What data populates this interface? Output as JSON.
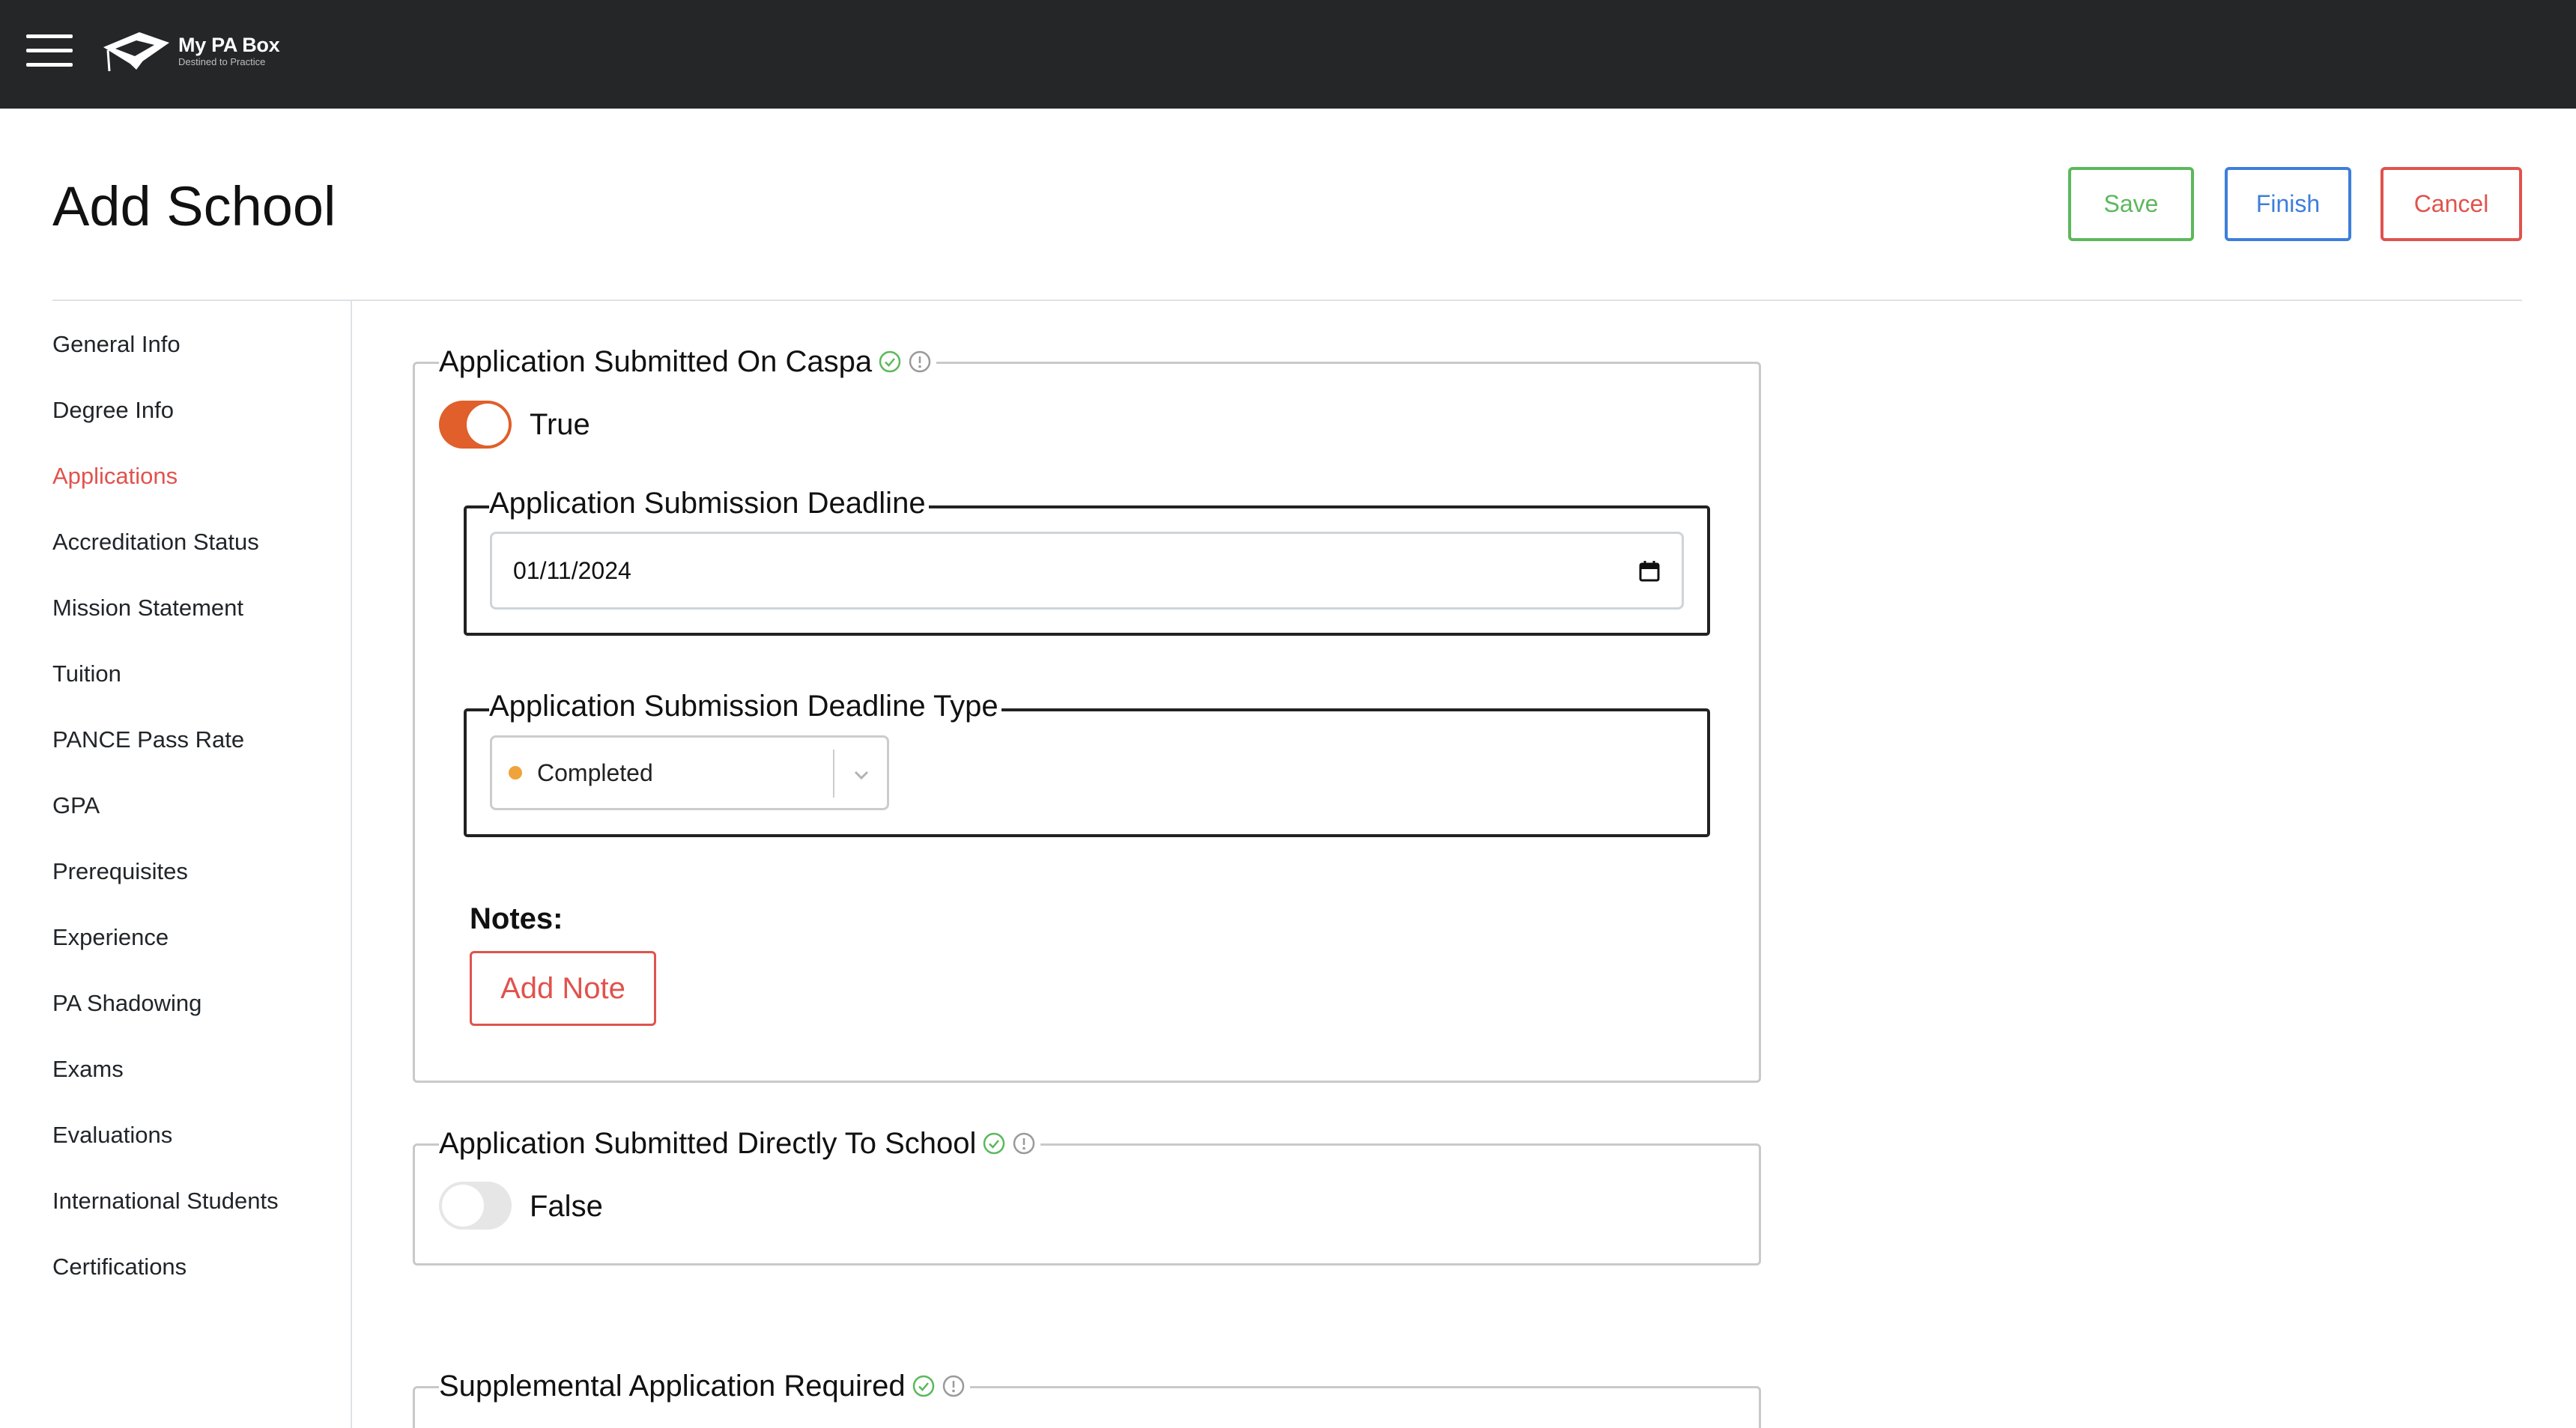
{
  "topbar": {
    "menu_icon": "hamburger-menu-icon",
    "logo_icon": "graduation-cap-logo",
    "app_name": "My PA Box",
    "tagline": "Destined to Practice"
  },
  "header": {
    "title": "Add School",
    "buttons": {
      "save": "Save",
      "finish": "Finish",
      "cancel": "Cancel"
    }
  },
  "sidebar": {
    "active": "Applications",
    "items": [
      "General Info",
      "Degree Info",
      "Applications",
      "Accreditation Status",
      "Mission Statement",
      "Tuition",
      "PANCE Pass Rate",
      "GPA",
      "Prerequisites",
      "Experience",
      "PA Shadowing",
      "Exams",
      "Evaluations",
      "International Students",
      "Certifications"
    ]
  },
  "colors": {
    "accent_red": "#e0534d",
    "save_green": "#5cb85c",
    "finish_blue": "#3d7edb",
    "toggle_on": "#e05f2a",
    "status_dot": "#f0a23b",
    "topbar_bg": "#252628"
  },
  "sections": {
    "caspa": {
      "legend": "Application Submitted On Caspa",
      "status_icons": [
        "check-circle-icon",
        "info-circle-icon"
      ],
      "toggle_on": true,
      "toggle_label": "True",
      "deadline": {
        "legend": "Application Submission Deadline",
        "value": "01/11/2024",
        "icon": "calendar-icon"
      },
      "deadline_type": {
        "legend": "Application Submission Deadline Type",
        "selected": "Completed",
        "icon": "chevron-down-icon"
      },
      "notes_label": "Notes:",
      "add_note_label": "Add Note"
    },
    "direct": {
      "legend": "Application Submitted Directly To School",
      "status_icons": [
        "check-circle-icon",
        "info-circle-icon"
      ],
      "toggle_on": false,
      "toggle_label": "False"
    },
    "supplemental": {
      "legend": "Supplemental Application Required",
      "status_icons": [
        "check-circle-icon",
        "info-circle-icon"
      ]
    }
  }
}
